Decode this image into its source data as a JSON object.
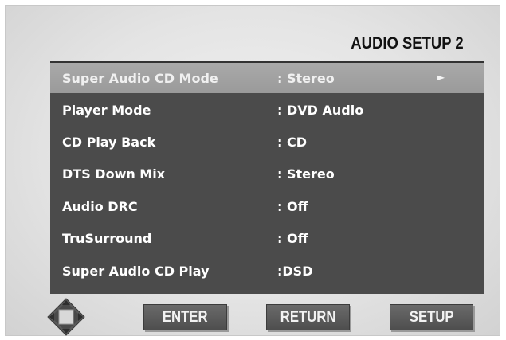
{
  "title": "AUDIO SETUP 2",
  "menu": [
    {
      "label": "Super Audio CD Mode",
      "value": ": Stereo",
      "selected": true,
      "arrow": "►"
    },
    {
      "label": "Player Mode",
      "value": ": DVD Audio"
    },
    {
      "label": "CD Play Back",
      "value": ": CD"
    },
    {
      "label": "DTS Down Mix",
      "value": ": Stereo"
    },
    {
      "label": "Audio DRC",
      "value": ": Off"
    },
    {
      "label": "TruSurround",
      "value": ": Off"
    },
    {
      "label": "Super Audio CD Play",
      "value": ":DSD"
    }
  ],
  "buttons": {
    "enter": "ENTER",
    "return": "RETURN",
    "setup": "SETUP"
  },
  "icons": {
    "navigation_pad": "direction-pad-icon",
    "submenu_arrow": "right-triangle-icon"
  },
  "colors": {
    "panel": "#4b4b4b",
    "selected_row": "#a4a4a4",
    "button": "#5a5a5a",
    "text": "#ffffff"
  }
}
